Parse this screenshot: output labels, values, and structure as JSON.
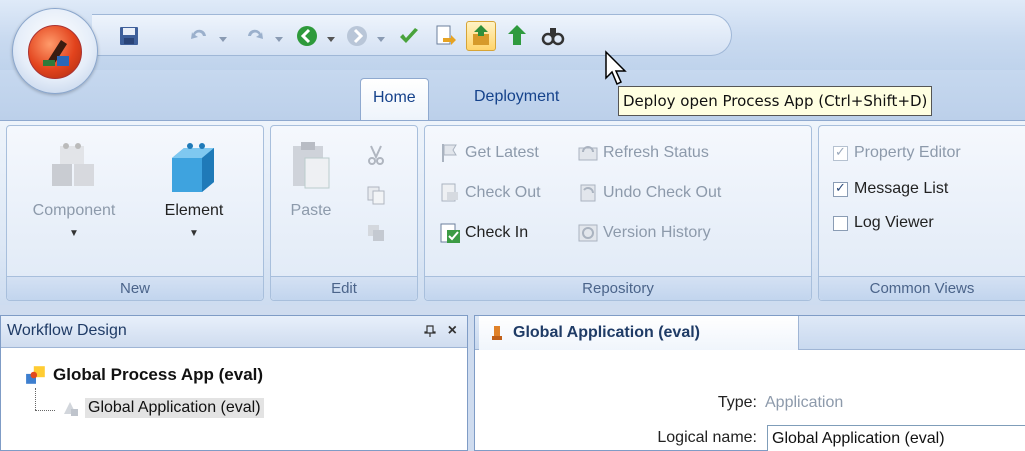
{
  "quick_access": {
    "buttons": [
      {
        "name": "save-icon"
      },
      {
        "name": "undo-icon"
      },
      {
        "name": "redo-icon"
      },
      {
        "name": "back-icon"
      },
      {
        "name": "forward-icon"
      },
      {
        "name": "validate-icon"
      },
      {
        "name": "export-icon"
      },
      {
        "name": "deploy-icon"
      },
      {
        "name": "deploy-all-icon"
      },
      {
        "name": "find-icon"
      }
    ]
  },
  "tabs": [
    {
      "label": "Home",
      "active": true
    },
    {
      "label": "Deployment",
      "active": false
    }
  ],
  "tooltip": "Deploy open Process App (Ctrl+Shift+D)",
  "ribbon": {
    "new_group": {
      "label": "New",
      "component": "Component",
      "element": "Element"
    },
    "edit_group": {
      "label": "Edit",
      "paste": "Paste"
    },
    "repository_group": {
      "label": "Repository",
      "get_latest": "Get Latest",
      "refresh_status": "Refresh Status",
      "check_out": "Check Out",
      "undo_check_out": "Undo Check Out",
      "check_in": "Check In",
      "version_history": "Version History"
    },
    "common_views_group": {
      "label": "Common Views",
      "property_editor": "Property Editor",
      "message_list": "Message List",
      "log_viewer": "Log Viewer"
    }
  },
  "workflow_pane": {
    "title": "Workflow Design",
    "pin": "ᅟ",
    "close": "×",
    "tree_root": "Global Process App (eval)",
    "tree_child": "Global Application (eval)"
  },
  "document": {
    "tab_title": "Global Application (eval)",
    "type_label": "Type:",
    "type_value": "Application",
    "logical_name_label": "Logical name:",
    "logical_name_value": "Global Application (eval)"
  },
  "colors": {
    "accent": "#15428b",
    "ribbon_border": "#a8bfdc",
    "tooltip_bg": "#ffffe1",
    "disabled_text": "#8d9aab"
  }
}
